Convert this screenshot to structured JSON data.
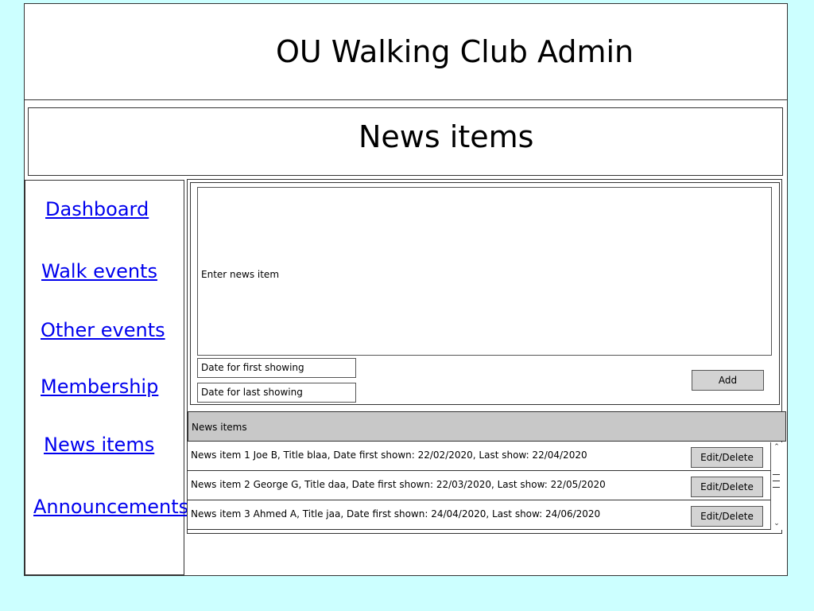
{
  "app": {
    "title": "OU Walking Club Admin"
  },
  "page": {
    "title": "News items"
  },
  "sidebar": {
    "items": [
      {
        "label": "Dashboard"
      },
      {
        "label": "Walk events"
      },
      {
        "label": "Other events"
      },
      {
        "label": "Membership"
      },
      {
        "label": "News items"
      },
      {
        "label": "Announcements"
      }
    ]
  },
  "form": {
    "news_placeholder": "Enter news item",
    "first_date_placeholder": "Date for first showing",
    "last_date_placeholder": "Date for last showing",
    "add_label": "Add"
  },
  "list": {
    "header": "News items",
    "rows": [
      {
        "text": "News item 1 Joe B, Title blaa, Date first shown: 22/02/2020, Last show: 22/04/2020",
        "action": "Edit/Delete"
      },
      {
        "text": "News item 2 George G, Title daa, Date first shown: 22/03/2020, Last show: 22/05/2020",
        "action": "Edit/Delete"
      },
      {
        "text": "News item 3 Ahmed A, Title jaa, Date first shown: 24/04/2020, Last show: 24/06/2020",
        "action": "Edit/Delete"
      }
    ]
  },
  "colors": {
    "background": "#ccffff",
    "link": "#0000ee",
    "button": "#d3d3d3",
    "list_header": "#c8c8c8"
  },
  "icons": {
    "scroll_up": "scroll-up-arrow-icon",
    "scroll_down": "scroll-down-arrow-icon"
  }
}
